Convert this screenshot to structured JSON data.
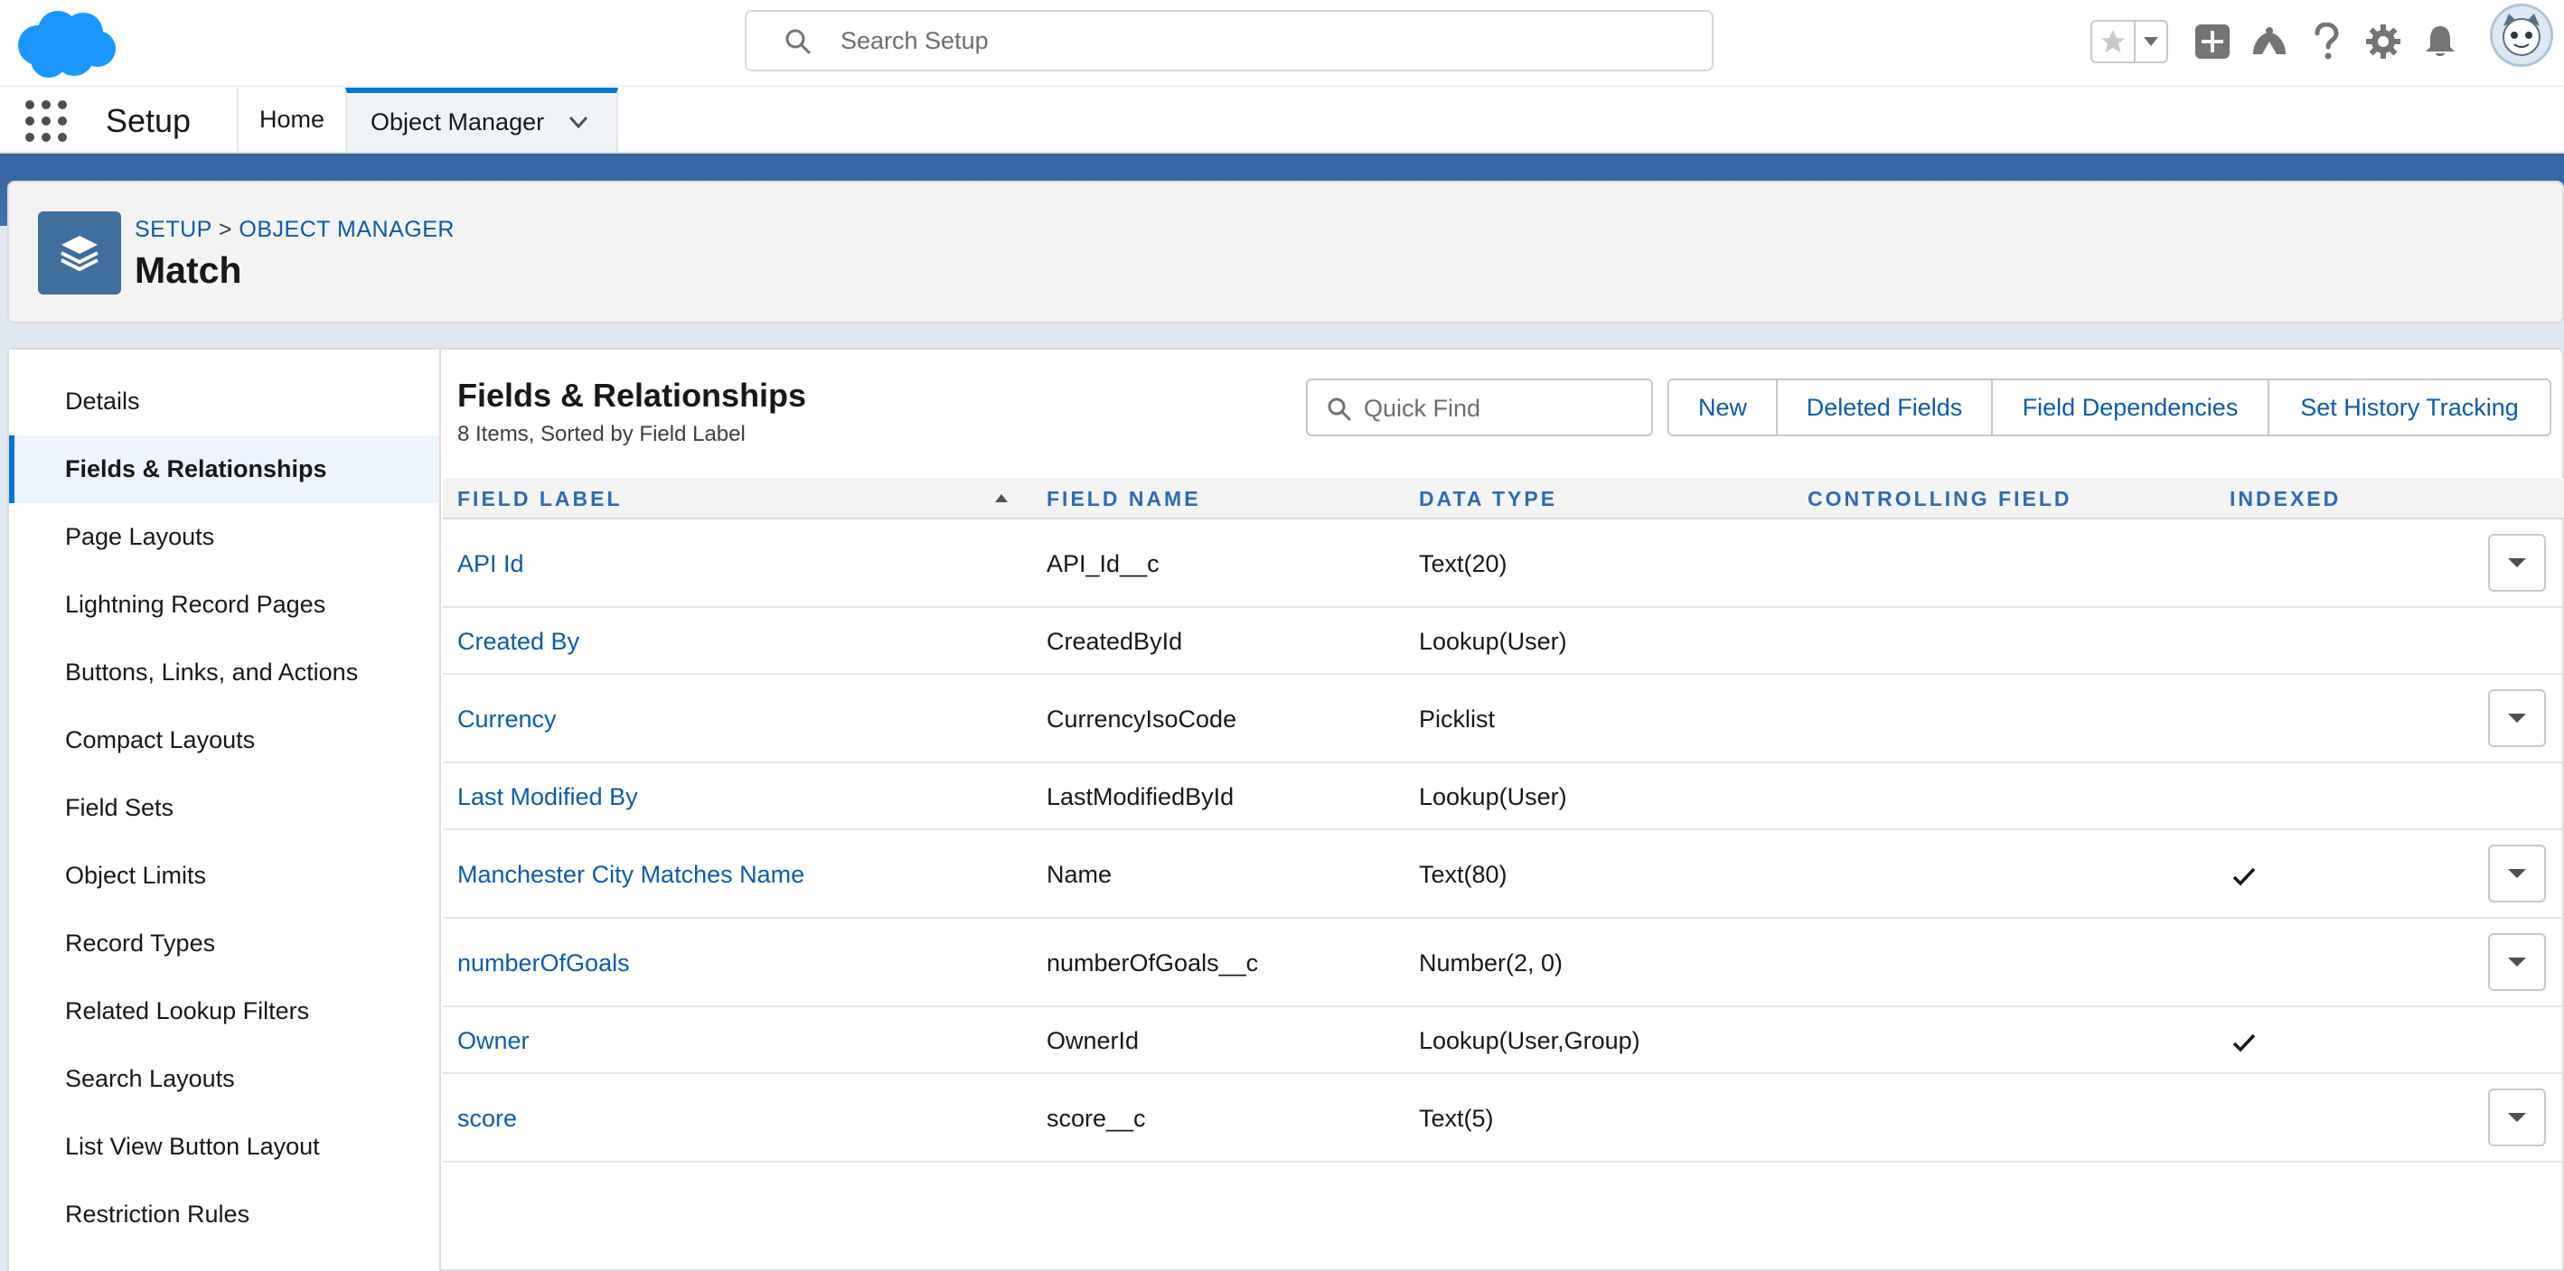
{
  "header": {
    "search_placeholder": "Search Setup",
    "logo_icon": "salesforce-cloud-logo",
    "icons": [
      "star-icon",
      "chevron-down-icon",
      "add-icon",
      "trailhead-icon",
      "help-icon",
      "gear-icon",
      "bell-icon",
      "avatar"
    ]
  },
  "app_nav": {
    "app_name": "Setup",
    "tabs": [
      {
        "label": "Home"
      },
      {
        "label": "Object Manager"
      }
    ]
  },
  "page_header": {
    "breadcrumb_setup": "SETUP",
    "breadcrumb_sep": ">",
    "breadcrumb_object_manager": "OBJECT MANAGER",
    "title": "Match"
  },
  "sidebar": {
    "items": [
      {
        "label": "Details"
      },
      {
        "label": "Fields & Relationships"
      },
      {
        "label": "Page Layouts"
      },
      {
        "label": "Lightning Record Pages"
      },
      {
        "label": "Buttons, Links, and Actions"
      },
      {
        "label": "Compact Layouts"
      },
      {
        "label": "Field Sets"
      },
      {
        "label": "Object Limits"
      },
      {
        "label": "Record Types"
      },
      {
        "label": "Related Lookup Filters"
      },
      {
        "label": "Search Layouts"
      },
      {
        "label": "List View Button Layout"
      },
      {
        "label": "Restriction Rules"
      }
    ]
  },
  "section": {
    "title": "Fields & Relationships",
    "subtitle": "8 Items, Sorted by Field Label",
    "quick_find_placeholder": "Quick Find",
    "buttons": {
      "new": "New",
      "deleted_fields": "Deleted Fields",
      "field_dependencies": "Field Dependencies",
      "set_history_tracking": "Set History Tracking"
    }
  },
  "table": {
    "columns": {
      "field_label": "FIELD LABEL",
      "field_name": "FIELD NAME",
      "data_type": "DATA TYPE",
      "controlling_field": "CONTROLLING FIELD",
      "indexed": "INDEXED"
    },
    "rows": [
      {
        "label": "API Id",
        "name": "API_Id__c",
        "type": "Text(20)",
        "controlling": "",
        "indexed": false,
        "has_action": true
      },
      {
        "label": "Created By",
        "name": "CreatedById",
        "type": "Lookup(User)",
        "controlling": "",
        "indexed": false,
        "has_action": false
      },
      {
        "label": "Currency",
        "name": "CurrencyIsoCode",
        "type": "Picklist",
        "controlling": "",
        "indexed": false,
        "has_action": true
      },
      {
        "label": "Last Modified By",
        "name": "LastModifiedById",
        "type": "Lookup(User)",
        "controlling": "",
        "indexed": false,
        "has_action": false
      },
      {
        "label": "Manchester City Matches Name",
        "name": "Name",
        "type": "Text(80)",
        "controlling": "",
        "indexed": true,
        "has_action": true
      },
      {
        "label": "numberOfGoals",
        "name": "numberOfGoals__c",
        "type": "Number(2, 0)",
        "controlling": "",
        "indexed": false,
        "has_action": true
      },
      {
        "label": "Owner",
        "name": "OwnerId",
        "type": "Lookup(User,Group)",
        "controlling": "",
        "indexed": true,
        "has_action": false
      },
      {
        "label": "score",
        "name": "score__c",
        "type": "Text(5)",
        "controlling": "",
        "indexed": false,
        "has_action": true
      }
    ]
  },
  "colors": {
    "brand_blue": "#0176d3",
    "link_blue": "#0b5cab",
    "header_band": "#3b6ea5",
    "object_icon": "#3e6f9c"
  }
}
